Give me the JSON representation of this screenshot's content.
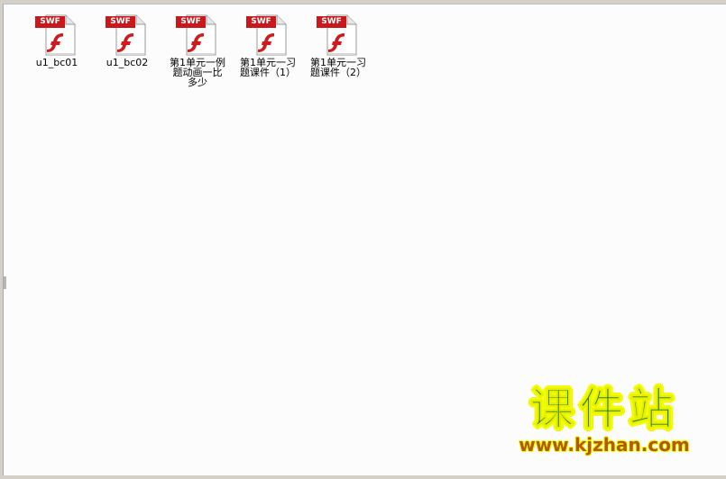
{
  "files": [
    {
      "name": "u1_bc01",
      "badge": "SWF",
      "icon": "flash-file-icon"
    },
    {
      "name": "u1_bc02",
      "badge": "SWF",
      "icon": "flash-file-icon"
    },
    {
      "name": "第1单元一例题动画一比多少",
      "badge": "SWF",
      "icon": "flash-file-icon"
    },
    {
      "name": "第1单元一习题课件（1）",
      "badge": "SWF",
      "icon": "flash-file-icon"
    },
    {
      "name": "第1单元一习题课件（2）",
      "badge": "SWF",
      "icon": "flash-file-icon"
    }
  ],
  "watermark": {
    "title": "课件站",
    "url": "www.kjzhan.com"
  },
  "colors": {
    "badge_red": "#c8181c",
    "flash_red": "#d01a1e",
    "watermark_green": "#2f7d0c",
    "watermark_yellow": "#f5ff00",
    "watermark_brown": "#b05a10"
  }
}
